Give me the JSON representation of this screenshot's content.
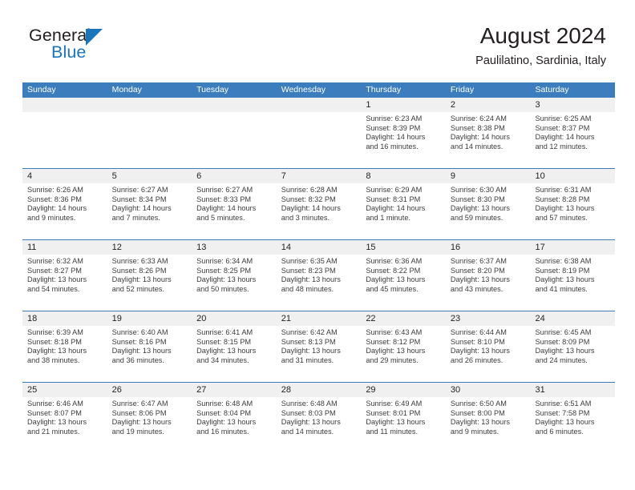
{
  "logo": {
    "text_primary": "General",
    "text_secondary": "Blue",
    "triangle_color": "#1b75bb"
  },
  "header": {
    "title": "August 2024",
    "subtitle": "Paulilatino, Sardinia, Italy"
  },
  "theme": {
    "header_blue": "#3c7dbe",
    "daynum_band": "#f0f0f0",
    "text": "#231f20"
  },
  "weekdays": [
    "Sunday",
    "Monday",
    "Tuesday",
    "Wednesday",
    "Thursday",
    "Friday",
    "Saturday"
  ],
  "labels": {
    "sunrise": "Sunrise:",
    "sunset": "Sunset:",
    "daylight": "Daylight:"
  },
  "weeks": [
    [
      {
        "day": "",
        "sunrise": "",
        "sunset": "",
        "daylight_line1": "",
        "daylight_line2": "",
        "empty": true
      },
      {
        "day": "",
        "sunrise": "",
        "sunset": "",
        "daylight_line1": "",
        "daylight_line2": "",
        "empty": true
      },
      {
        "day": "",
        "sunrise": "",
        "sunset": "",
        "daylight_line1": "",
        "daylight_line2": "",
        "empty": true
      },
      {
        "day": "",
        "sunrise": "",
        "sunset": "",
        "daylight_line1": "",
        "daylight_line2": "",
        "empty": true
      },
      {
        "day": "1",
        "sunrise": "Sunrise: 6:23 AM",
        "sunset": "Sunset: 8:39 PM",
        "daylight_line1": "Daylight: 14 hours",
        "daylight_line2": "and 16 minutes.",
        "empty": false
      },
      {
        "day": "2",
        "sunrise": "Sunrise: 6:24 AM",
        "sunset": "Sunset: 8:38 PM",
        "daylight_line1": "Daylight: 14 hours",
        "daylight_line2": "and 14 minutes.",
        "empty": false
      },
      {
        "day": "3",
        "sunrise": "Sunrise: 6:25 AM",
        "sunset": "Sunset: 8:37 PM",
        "daylight_line1": "Daylight: 14 hours",
        "daylight_line2": "and 12 minutes.",
        "empty": false
      }
    ],
    [
      {
        "day": "4",
        "sunrise": "Sunrise: 6:26 AM",
        "sunset": "Sunset: 8:36 PM",
        "daylight_line1": "Daylight: 14 hours",
        "daylight_line2": "and 9 minutes.",
        "empty": false
      },
      {
        "day": "5",
        "sunrise": "Sunrise: 6:27 AM",
        "sunset": "Sunset: 8:34 PM",
        "daylight_line1": "Daylight: 14 hours",
        "daylight_line2": "and 7 minutes.",
        "empty": false
      },
      {
        "day": "6",
        "sunrise": "Sunrise: 6:27 AM",
        "sunset": "Sunset: 8:33 PM",
        "daylight_line1": "Daylight: 14 hours",
        "daylight_line2": "and 5 minutes.",
        "empty": false
      },
      {
        "day": "7",
        "sunrise": "Sunrise: 6:28 AM",
        "sunset": "Sunset: 8:32 PM",
        "daylight_line1": "Daylight: 14 hours",
        "daylight_line2": "and 3 minutes.",
        "empty": false
      },
      {
        "day": "8",
        "sunrise": "Sunrise: 6:29 AM",
        "sunset": "Sunset: 8:31 PM",
        "daylight_line1": "Daylight: 14 hours",
        "daylight_line2": "and 1 minute.",
        "empty": false
      },
      {
        "day": "9",
        "sunrise": "Sunrise: 6:30 AM",
        "sunset": "Sunset: 8:30 PM",
        "daylight_line1": "Daylight: 13 hours",
        "daylight_line2": "and 59 minutes.",
        "empty": false
      },
      {
        "day": "10",
        "sunrise": "Sunrise: 6:31 AM",
        "sunset": "Sunset: 8:28 PM",
        "daylight_line1": "Daylight: 13 hours",
        "daylight_line2": "and 57 minutes.",
        "empty": false
      }
    ],
    [
      {
        "day": "11",
        "sunrise": "Sunrise: 6:32 AM",
        "sunset": "Sunset: 8:27 PM",
        "daylight_line1": "Daylight: 13 hours",
        "daylight_line2": "and 54 minutes.",
        "empty": false
      },
      {
        "day": "12",
        "sunrise": "Sunrise: 6:33 AM",
        "sunset": "Sunset: 8:26 PM",
        "daylight_line1": "Daylight: 13 hours",
        "daylight_line2": "and 52 minutes.",
        "empty": false
      },
      {
        "day": "13",
        "sunrise": "Sunrise: 6:34 AM",
        "sunset": "Sunset: 8:25 PM",
        "daylight_line1": "Daylight: 13 hours",
        "daylight_line2": "and 50 minutes.",
        "empty": false
      },
      {
        "day": "14",
        "sunrise": "Sunrise: 6:35 AM",
        "sunset": "Sunset: 8:23 PM",
        "daylight_line1": "Daylight: 13 hours",
        "daylight_line2": "and 48 minutes.",
        "empty": false
      },
      {
        "day": "15",
        "sunrise": "Sunrise: 6:36 AM",
        "sunset": "Sunset: 8:22 PM",
        "daylight_line1": "Daylight: 13 hours",
        "daylight_line2": "and 45 minutes.",
        "empty": false
      },
      {
        "day": "16",
        "sunrise": "Sunrise: 6:37 AM",
        "sunset": "Sunset: 8:20 PM",
        "daylight_line1": "Daylight: 13 hours",
        "daylight_line2": "and 43 minutes.",
        "empty": false
      },
      {
        "day": "17",
        "sunrise": "Sunrise: 6:38 AM",
        "sunset": "Sunset: 8:19 PM",
        "daylight_line1": "Daylight: 13 hours",
        "daylight_line2": "and 41 minutes.",
        "empty": false
      }
    ],
    [
      {
        "day": "18",
        "sunrise": "Sunrise: 6:39 AM",
        "sunset": "Sunset: 8:18 PM",
        "daylight_line1": "Daylight: 13 hours",
        "daylight_line2": "and 38 minutes.",
        "empty": false
      },
      {
        "day": "19",
        "sunrise": "Sunrise: 6:40 AM",
        "sunset": "Sunset: 8:16 PM",
        "daylight_line1": "Daylight: 13 hours",
        "daylight_line2": "and 36 minutes.",
        "empty": false
      },
      {
        "day": "20",
        "sunrise": "Sunrise: 6:41 AM",
        "sunset": "Sunset: 8:15 PM",
        "daylight_line1": "Daylight: 13 hours",
        "daylight_line2": "and 34 minutes.",
        "empty": false
      },
      {
        "day": "21",
        "sunrise": "Sunrise: 6:42 AM",
        "sunset": "Sunset: 8:13 PM",
        "daylight_line1": "Daylight: 13 hours",
        "daylight_line2": "and 31 minutes.",
        "empty": false
      },
      {
        "day": "22",
        "sunrise": "Sunrise: 6:43 AM",
        "sunset": "Sunset: 8:12 PM",
        "daylight_line1": "Daylight: 13 hours",
        "daylight_line2": "and 29 minutes.",
        "empty": false
      },
      {
        "day": "23",
        "sunrise": "Sunrise: 6:44 AM",
        "sunset": "Sunset: 8:10 PM",
        "daylight_line1": "Daylight: 13 hours",
        "daylight_line2": "and 26 minutes.",
        "empty": false
      },
      {
        "day": "24",
        "sunrise": "Sunrise: 6:45 AM",
        "sunset": "Sunset: 8:09 PM",
        "daylight_line1": "Daylight: 13 hours",
        "daylight_line2": "and 24 minutes.",
        "empty": false
      }
    ],
    [
      {
        "day": "25",
        "sunrise": "Sunrise: 6:46 AM",
        "sunset": "Sunset: 8:07 PM",
        "daylight_line1": "Daylight: 13 hours",
        "daylight_line2": "and 21 minutes.",
        "empty": false
      },
      {
        "day": "26",
        "sunrise": "Sunrise: 6:47 AM",
        "sunset": "Sunset: 8:06 PM",
        "daylight_line1": "Daylight: 13 hours",
        "daylight_line2": "and 19 minutes.",
        "empty": false
      },
      {
        "day": "27",
        "sunrise": "Sunrise: 6:48 AM",
        "sunset": "Sunset: 8:04 PM",
        "daylight_line1": "Daylight: 13 hours",
        "daylight_line2": "and 16 minutes.",
        "empty": false
      },
      {
        "day": "28",
        "sunrise": "Sunrise: 6:48 AM",
        "sunset": "Sunset: 8:03 PM",
        "daylight_line1": "Daylight: 13 hours",
        "daylight_line2": "and 14 minutes.",
        "empty": false
      },
      {
        "day": "29",
        "sunrise": "Sunrise: 6:49 AM",
        "sunset": "Sunset: 8:01 PM",
        "daylight_line1": "Daylight: 13 hours",
        "daylight_line2": "and 11 minutes.",
        "empty": false
      },
      {
        "day": "30",
        "sunrise": "Sunrise: 6:50 AM",
        "sunset": "Sunset: 8:00 PM",
        "daylight_line1": "Daylight: 13 hours",
        "daylight_line2": "and 9 minutes.",
        "empty": false
      },
      {
        "day": "31",
        "sunrise": "Sunrise: 6:51 AM",
        "sunset": "Sunset: 7:58 PM",
        "daylight_line1": "Daylight: 13 hours",
        "daylight_line2": "and 6 minutes.",
        "empty": false
      }
    ]
  ]
}
